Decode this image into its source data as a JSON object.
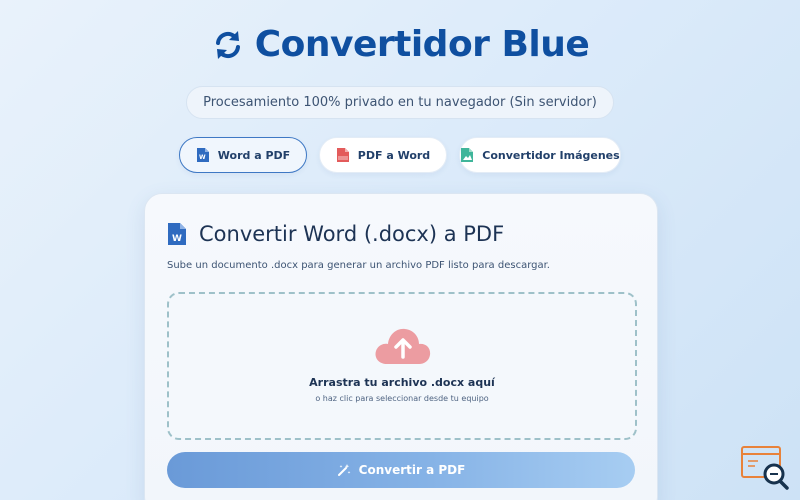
{
  "app": {
    "title": "Convertidor Blue",
    "subtitle": "Procesamiento 100% privado en tu navegador (Sin servidor)"
  },
  "tabs": [
    {
      "label": "Word a PDF",
      "icon": "word-file-icon",
      "active": true
    },
    {
      "label": "PDF a Word",
      "icon": "pdf-file-icon",
      "active": false
    },
    {
      "label": "Convertidor Imágenes",
      "icon": "image-file-icon",
      "active": false
    }
  ],
  "card": {
    "title": "Convertir Word (.docx) a PDF",
    "description": "Sube un documento .docx para generar un archivo PDF listo para descargar.",
    "dropzone": {
      "title": "Arrastra tu archivo .docx aquí",
      "subtitle": "o haz clic para seleccionar desde tu equipo",
      "icon": "cloud-upload-icon"
    },
    "convert_button": {
      "label": "Convertir a PDF",
      "icon": "magic-wand-icon"
    }
  },
  "colors": {
    "brand": "#0f4fa0",
    "accent": "#3e78c4",
    "word": "#2f6bc0",
    "pdf": "#e35b5b",
    "image": "#3fb59a",
    "upload": "#e98a90",
    "widget": "#e8823a"
  }
}
